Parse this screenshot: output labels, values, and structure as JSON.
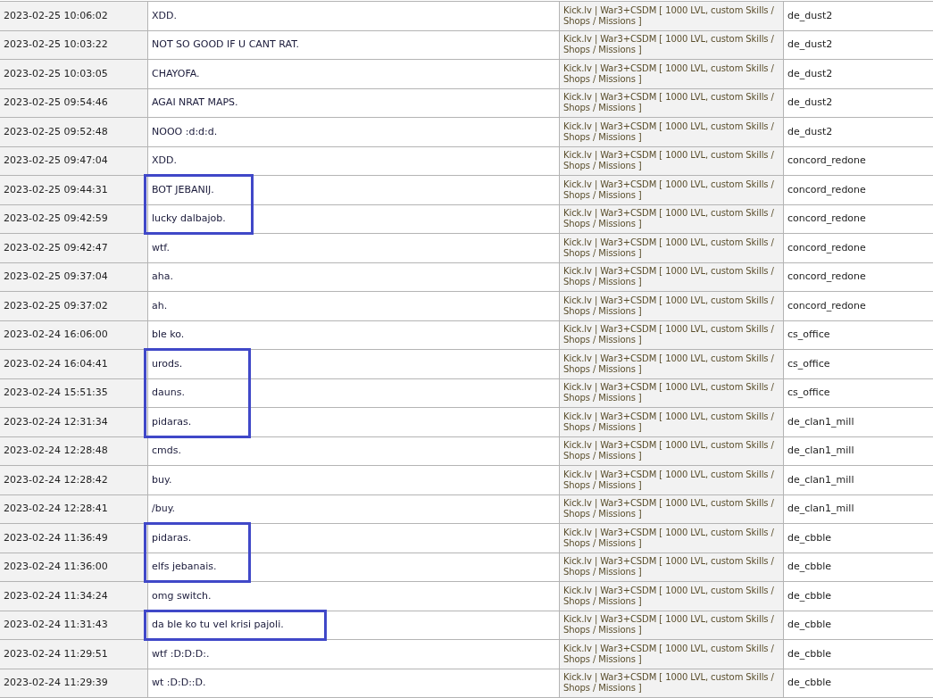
{
  "rows": [
    {
      "time": "2023-02-25 10:06:02",
      "message": "XDD.",
      "server": "Kick.lv | War3+CSDM [ 1000 LVL, custom Skills / Shops / Missions ]",
      "map": "de_dust2",
      "highlighted": false
    },
    {
      "time": "2023-02-25 10:03:22",
      "message": "NOT SO GOOD IF U CANT RAT.",
      "server": "Kick.lv | War3+CSDM [ 1000 LVL, custom Skills / Shops / Missions ]",
      "map": "de_dust2",
      "highlighted": false
    },
    {
      "time": "2023-02-25 10:03:05",
      "message": "CHAYOFA.",
      "server": "Kick.lv | War3+CSDM [ 1000 LVL, custom Skills / Shops / Missions ]",
      "map": "de_dust2",
      "highlighted": false
    },
    {
      "time": "2023-02-25 09:54:46",
      "message": "AGAI NRAT MAPS.",
      "server": "Kick.lv | War3+CSDM [ 1000 LVL, custom Skills / Shops / Missions ]",
      "map": "de_dust2",
      "highlighted": false
    },
    {
      "time": "2023-02-25 09:52:48",
      "message": "NOOO :d:d:d.",
      "server": "Kick.lv | War3+CSDM [ 1000 LVL, custom Skills / Shops / Missions ]",
      "map": "de_dust2",
      "highlighted": false
    },
    {
      "time": "2023-02-25 09:47:04",
      "message": "XDD.",
      "server": "Kick.lv | War3+CSDM [ 1000 LVL, custom Skills / Shops / Missions ]",
      "map": "concord_redone",
      "highlighted": false
    },
    {
      "time": "2023-02-25 09:44:31",
      "message": "BOT JEBANIJ.",
      "server": "Kick.lv | War3+CSDM [ 1000 LVL, custom Skills / Shops / Missions ]",
      "map": "concord_redone",
      "highlighted": true
    },
    {
      "time": "2023-02-25 09:42:59",
      "message": "lucky dalbajob.",
      "server": "Kick.lv | War3+CSDM [ 1000 LVL, custom Skills / Shops / Missions ]",
      "map": "concord_redone",
      "highlighted": true
    },
    {
      "time": "2023-02-25 09:42:47",
      "message": "wtf.",
      "server": "Kick.lv | War3+CSDM [ 1000 LVL, custom Skills / Shops / Missions ]",
      "map": "concord_redone",
      "highlighted": false
    },
    {
      "time": "2023-02-25 09:37:04",
      "message": "aha.",
      "server": "Kick.lv | War3+CSDM [ 1000 LVL, custom Skills / Shops / Missions ]",
      "map": "concord_redone",
      "highlighted": false
    },
    {
      "time": "2023-02-25 09:37:02",
      "message": "ah.",
      "server": "Kick.lv | War3+CSDM [ 1000 LVL, custom Skills / Shops / Missions ]",
      "map": "concord_redone",
      "highlighted": false
    },
    {
      "time": "2023-02-24 16:06:00",
      "message": "ble ko.",
      "server": "Kick.lv | War3+CSDM [ 1000 LVL, custom Skills / Shops / Missions ]",
      "map": "cs_office",
      "highlighted": false
    },
    {
      "time": "2023-02-24 16:04:41",
      "message": "urods.",
      "server": "Kick.lv | War3+CSDM [ 1000 LVL, custom Skills / Shops / Missions ]",
      "map": "cs_office",
      "highlighted": true
    },
    {
      "time": "2023-02-24 15:51:35",
      "message": "dauns.",
      "server": "Kick.lv | War3+CSDM [ 1000 LVL, custom Skills / Shops / Missions ]",
      "map": "cs_office",
      "highlighted": true
    },
    {
      "time": "2023-02-24 12:31:34",
      "message": "pidaras.",
      "server": "Kick.lv | War3+CSDM [ 1000 LVL, custom Skills / Shops / Missions ]",
      "map": "de_clan1_mill",
      "highlighted": true
    },
    {
      "time": "2023-02-24 12:28:48",
      "message": "cmds.",
      "server": "Kick.lv | War3+CSDM [ 1000 LVL, custom Skills / Shops / Missions ]",
      "map": "de_clan1_mill",
      "highlighted": false
    },
    {
      "time": "2023-02-24 12:28:42",
      "message": "buy.",
      "server": "Kick.lv | War3+CSDM [ 1000 LVL, custom Skills / Shops / Missions ]",
      "map": "de_clan1_mill",
      "highlighted": false
    },
    {
      "time": "2023-02-24 12:28:41",
      "message": "/buy.",
      "server": "Kick.lv | War3+CSDM [ 1000 LVL, custom Skills / Shops / Missions ]",
      "map": "de_clan1_mill",
      "highlighted": false
    },
    {
      "time": "2023-02-24 11:36:49",
      "message": "pidaras.",
      "server": "Kick.lv | War3+CSDM [ 1000 LVL, custom Skills / Shops / Missions ]",
      "map": "de_cbble",
      "highlighted": true
    },
    {
      "time": "2023-02-24 11:36:00",
      "message": "elfs jebanais.",
      "server": "Kick.lv | War3+CSDM [ 1000 LVL, custom Skills / Shops / Missions ]",
      "map": "de_cbble",
      "highlighted": true
    },
    {
      "time": "2023-02-24 11:34:24",
      "message": "omg switch.",
      "server": "Kick.lv | War3+CSDM [ 1000 LVL, custom Skills / Shops / Missions ]",
      "map": "de_cbble",
      "highlighted": false
    },
    {
      "time": "2023-02-24 11:31:43",
      "message": "da ble ko tu vel krisi pajoli.",
      "server": "Kick.lv | War3+CSDM [ 1000 LVL, custom Skills / Shops / Missions ]",
      "map": "de_cbble",
      "highlighted": true
    },
    {
      "time": "2023-02-24 11:29:51",
      "message": "wtf :D:D:D:.",
      "server": "Kick.lv | War3+CSDM [ 1000 LVL, custom Skills / Shops / Missions ]",
      "map": "de_cbble",
      "highlighted": false
    },
    {
      "time": "2023-02-24 11:29:39",
      "message": "wt :D:D::D.",
      "server": "Kick.lv | War3+CSDM [ 1000 LVL, custom Skills / Shops / Missions ]",
      "map": "de_cbble",
      "highlighted": false
    }
  ]
}
